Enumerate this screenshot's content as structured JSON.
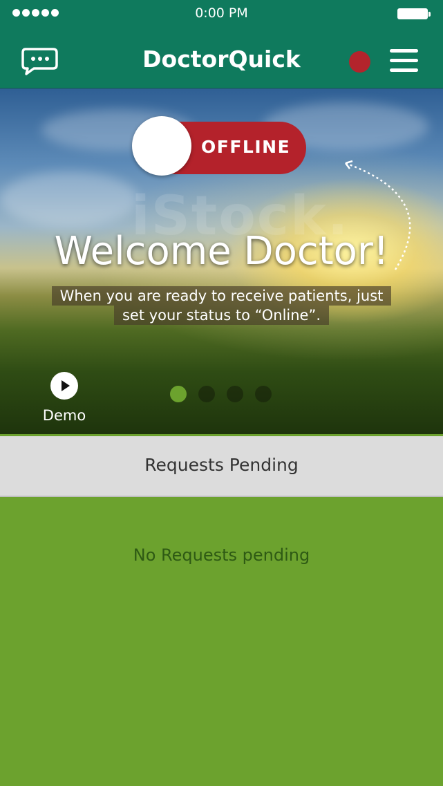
{
  "status_bar": {
    "time": "0:00 PM",
    "signal_dots": 5
  },
  "header": {
    "app_title": "DoctorQuick",
    "status_indicator_color": "#b3242c",
    "brand_color": "#0f7a5d"
  },
  "hero": {
    "toggle_label": "OFFLINE",
    "watermark": "iStock.",
    "welcome": "Welcome Doctor!",
    "subtitle_line1": "When you are ready to receive patients, just",
    "subtitle_line2": "set your status to “Online”.",
    "demo_label": "Demo",
    "pager": {
      "page_count": 4,
      "active_page": 1
    }
  },
  "requests": {
    "title": "Requests Pending",
    "empty_message": "No Requests pending"
  },
  "icons": [
    "chat-icon",
    "menu-icon",
    "play-icon",
    "battery-icon"
  ]
}
